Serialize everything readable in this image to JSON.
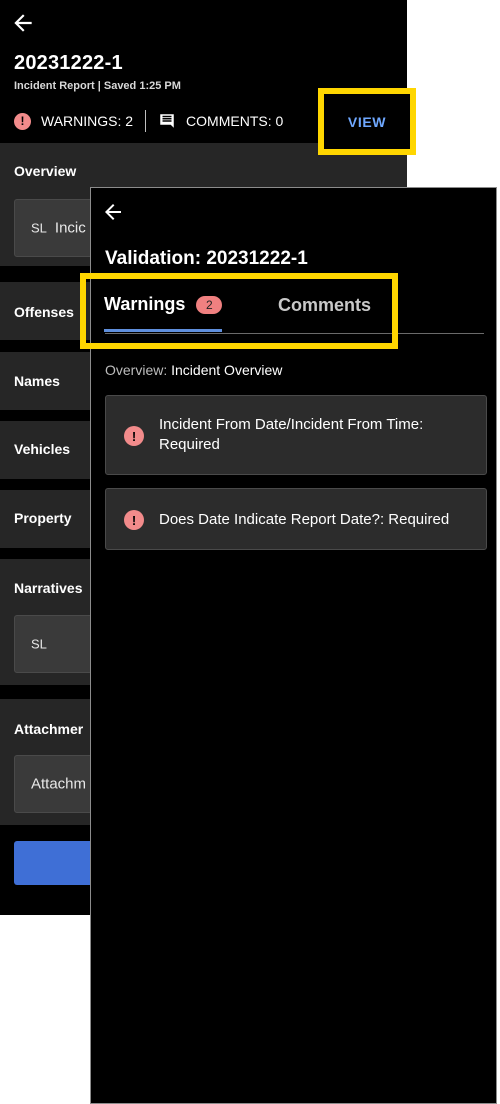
{
  "report": {
    "title": "20231222-1",
    "subtitle": "Incident Report | Saved 1:25 PM",
    "warnings_label": "WARNINGS: 2",
    "comments_label": "COMMENTS: 0",
    "view_label": "VIEW"
  },
  "sections": {
    "overview": {
      "label": "Overview",
      "field_prefix": "SL",
      "field_text": "Incic"
    },
    "offenses": {
      "label": "Offenses"
    },
    "names": {
      "label": "Names"
    },
    "vehicles": {
      "label": "Vehicles"
    },
    "property": {
      "label": "Property"
    },
    "narratives": {
      "label": "Narratives",
      "field_prefix": "SL"
    },
    "attachments": {
      "label": "Attachmer",
      "field_text": "Attachm"
    }
  },
  "validation": {
    "title": "Validation: 20231222-1",
    "tabs": {
      "warnings_label": "Warnings",
      "warnings_count": "2",
      "comments_label": "Comments"
    },
    "overview_prefix": "Overview: ",
    "overview_name": "Incident Overview",
    "warnings": [
      {
        "text": "Incident From Date/Incident From Time: Required"
      },
      {
        "text": "Does Date Indicate Report Date?: Required"
      }
    ]
  },
  "icons": {
    "warning": "!",
    "back": "left-arrow-icon",
    "comment": "comment-icon"
  },
  "colors": {
    "highlight": "#ffd600",
    "warning": "#f28b8b",
    "link": "#6fa8ff",
    "tab_underline": "#5f8fdd",
    "primary_button": "#3f6fd6"
  }
}
